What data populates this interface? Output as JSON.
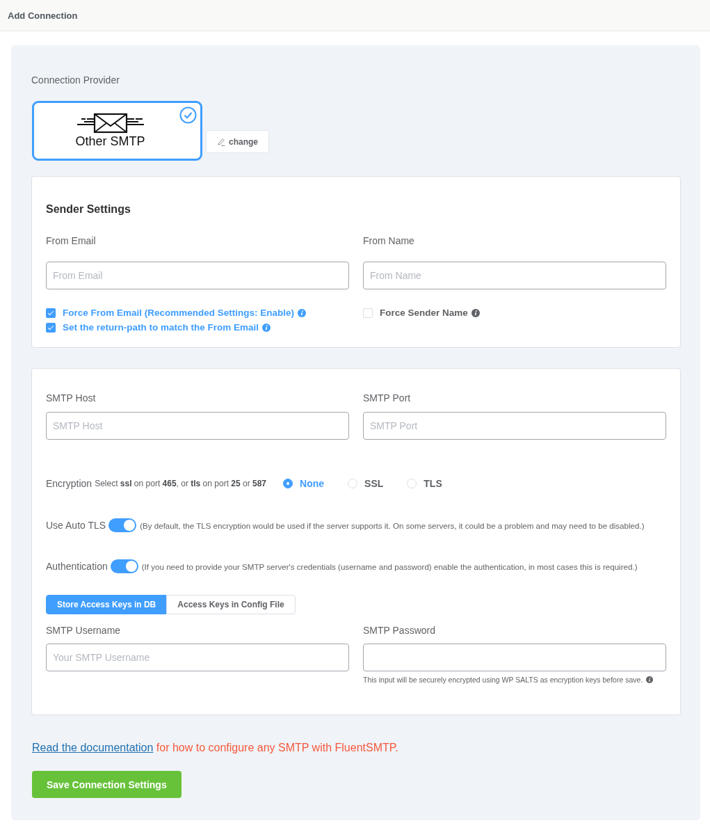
{
  "header": {
    "title": "Add Connection"
  },
  "provider": {
    "label": "Connection Provider",
    "name": "Other SMTP",
    "selected": true,
    "change_button": "change"
  },
  "sender_settings": {
    "title": "Sender Settings",
    "fields": [
      {
        "label": "From Email",
        "placeholder": "From Email",
        "options": [
          {
            "label": "Force From Email (Recommended Settings: Enable)",
            "checked": true
          },
          {
            "label": "Set the return-path to match the From Email",
            "checked": true
          }
        ]
      },
      {
        "label": "From Name",
        "placeholder": "From Name",
        "options": [
          {
            "label": "Force Sender Name",
            "checked": false
          }
        ]
      }
    ]
  },
  "smtp_settings": {
    "server_fields": [
      {
        "label": "SMTP Host",
        "placeholder": "SMTP Host"
      },
      {
        "label": "SMTP Port",
        "placeholder": "SMTP Port"
      }
    ],
    "encryption": {
      "label": "Encryption",
      "hint": "Select **ssl** on port **465**, or **tls** on port **25** or **587**",
      "options": [
        {
          "label": "None",
          "selected": true
        },
        {
          "label": "SSL",
          "selected": false
        },
        {
          "label": "TLS",
          "selected": false
        }
      ]
    },
    "toggles": [
      {
        "label": "Use Auto TLS",
        "on": true,
        "note": "(By default, the TLS encryption would be used if the server supports it. On some servers, it could be a problem and may need to be disabled.)"
      },
      {
        "label": "Authentication",
        "on": true,
        "note": "(If you need to provide your SMTP server's credentials (username and password) enable the authentication, in most cases this is required.)"
      }
    ],
    "key_tabs": [
      {
        "label": "Store Access Keys in DB",
        "selected": true
      },
      {
        "label": "Access Keys in Config File",
        "selected": false
      }
    ],
    "credential_fields": [
      {
        "label": "SMTP Username",
        "placeholder": "Your SMTP Username"
      },
      {
        "label": "SMTP Password",
        "help": "This input will be securely encrypted using WP SALTS as encryption keys before save."
      }
    ]
  },
  "documentation": {
    "link": "Read the documentation",
    "text": "for how to configure any SMTP with FluentSMTP."
  },
  "save_button": "Save Connection Settings"
}
